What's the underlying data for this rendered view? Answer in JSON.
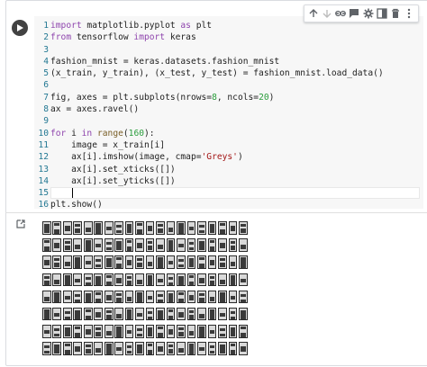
{
  "toolbar": {
    "buttons": [
      {
        "name": "move-up-icon",
        "glyph": "up"
      },
      {
        "name": "move-down-icon",
        "glyph": "down"
      },
      {
        "name": "link-icon",
        "glyph": "link"
      },
      {
        "name": "comment-icon",
        "glyph": "comment"
      },
      {
        "name": "settings-icon",
        "glyph": "gear"
      },
      {
        "name": "mirror-icon",
        "glyph": "mirror"
      },
      {
        "name": "delete-icon",
        "glyph": "trash"
      },
      {
        "name": "more-icon",
        "glyph": "more"
      }
    ]
  },
  "code": {
    "line_numbers": [
      "1",
      "2",
      "3",
      "4",
      "5",
      "6",
      "7",
      "8",
      "9",
      "10",
      "11",
      "12",
      "13",
      "14",
      "15",
      "16"
    ],
    "lines": [
      [
        {
          "t": "import",
          "c": "kw"
        },
        {
          "t": " matplotlib.pyplot ",
          "c": ""
        },
        {
          "t": "as",
          "c": "kw"
        },
        {
          "t": " plt",
          "c": ""
        }
      ],
      [
        {
          "t": "from",
          "c": "kw"
        },
        {
          "t": " tensorflow ",
          "c": ""
        },
        {
          "t": "import",
          "c": "kw"
        },
        {
          "t": " keras",
          "c": ""
        }
      ],
      [],
      [
        {
          "t": "fashion_mnist = keras.datasets.fashion_mnist",
          "c": ""
        }
      ],
      [
        {
          "t": "(x_train, y_train), (x_test, y_test) = fashion_mnist.load_data()",
          "c": ""
        }
      ],
      [],
      [
        {
          "t": "fig, axes = plt.subplots(nrows=",
          "c": ""
        },
        {
          "t": "8",
          "c": "num"
        },
        {
          "t": ", ncols=",
          "c": ""
        },
        {
          "t": "20",
          "c": "num"
        },
        {
          "t": ")",
          "c": ""
        }
      ],
      [
        {
          "t": "ax = axes.ravel()",
          "c": ""
        }
      ],
      [],
      [
        {
          "t": "for",
          "c": "kw"
        },
        {
          "t": " i ",
          "c": ""
        },
        {
          "t": "in",
          "c": "kw"
        },
        {
          "t": " ",
          "c": ""
        },
        {
          "t": "range",
          "c": "fn"
        },
        {
          "t": "(",
          "c": ""
        },
        {
          "t": "160",
          "c": "num"
        },
        {
          "t": "):",
          "c": ""
        }
      ],
      [
        {
          "t": "    image = x_train[i]",
          "c": ""
        }
      ],
      [
        {
          "t": "    ax[i].imshow(image, cmap=",
          "c": ""
        },
        {
          "t": "'Greys'",
          "c": "str"
        },
        {
          "t": ")",
          "c": ""
        }
      ],
      [
        {
          "t": "    ax[i].set_xticks([])",
          "c": ""
        }
      ],
      [
        {
          "t": "    ax[i].set_yticks([])",
          "c": ""
        }
      ],
      [
        {
          "t": "    ",
          "c": ""
        }
      ],
      [
        {
          "t": "plt.show()",
          "c": ""
        }
      ]
    ],
    "active_line": 14
  },
  "output": {
    "rows": 8,
    "cols": 20
  }
}
